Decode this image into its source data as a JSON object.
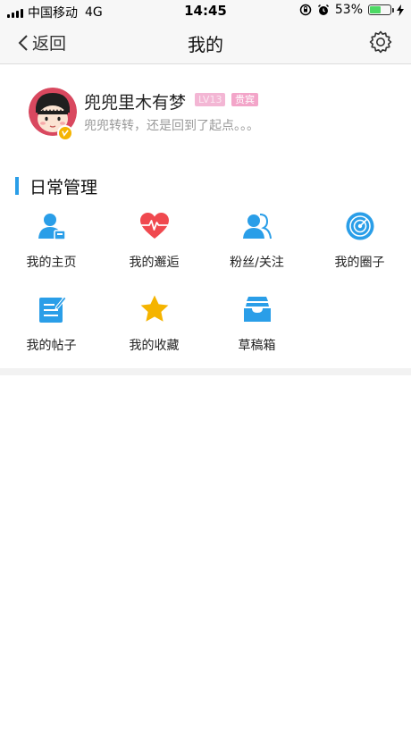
{
  "status_bar": {
    "carrier": "中国移动",
    "network": "4G",
    "time": "14:45",
    "battery_percent": "53%",
    "battery_level": 0.53
  },
  "nav": {
    "back_label": "返回",
    "title": "我的"
  },
  "profile": {
    "username": "兜兜里木有梦",
    "level_tag": "LV13",
    "role_tag": "贵宾",
    "signature": "兜兜转转，还是回到了起点。。。"
  },
  "section": {
    "title": "日常管理",
    "items": [
      {
        "label": "我的主页",
        "icon": "user-home-icon"
      },
      {
        "label": "我的邂逅",
        "icon": "heartbeat-icon"
      },
      {
        "label": "粉丝/关注",
        "icon": "users-icon"
      },
      {
        "label": "我的圈子",
        "icon": "target-circle-icon"
      },
      {
        "label": "我的帖子",
        "icon": "edit-note-icon"
      },
      {
        "label": "我的收藏",
        "icon": "star-icon"
      },
      {
        "label": "草稿箱",
        "icon": "inbox-tray-icon"
      }
    ]
  },
  "colors": {
    "accent_blue": "#2a9ee8",
    "heart_red": "#f0494f",
    "star_yellow": "#f5b400",
    "tag_pink": "#f3a5c9"
  }
}
